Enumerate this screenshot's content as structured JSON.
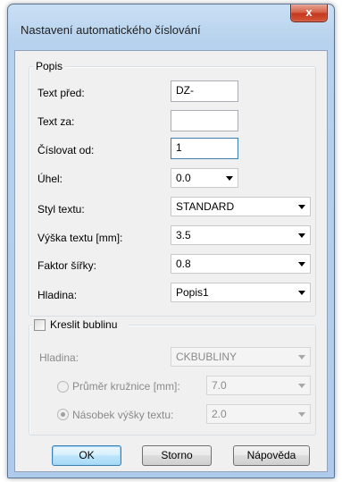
{
  "window": {
    "title": "Nastavení automatického číslování",
    "close_glyph": "x"
  },
  "popis": {
    "legend": "Popis",
    "text_pred": {
      "label": "Text před:",
      "value": "DZ-"
    },
    "text_za": {
      "label": "Text za:",
      "value": ""
    },
    "cislovat_od": {
      "label": "Číslovat od:",
      "value": "1"
    },
    "uhel": {
      "label": "Úhel:",
      "value": "0.0"
    },
    "styl_textu": {
      "label": "Styl textu:",
      "value": "STANDARD"
    },
    "vyska_textu": {
      "label": "Výška textu [mm]:",
      "value": "3.5"
    },
    "faktor_sirky": {
      "label": "Faktor šířky:",
      "value": "0.8"
    },
    "hladina": {
      "label": "Hladina:",
      "value": "Popis1"
    }
  },
  "bublina": {
    "checkbox_label": "Kreslit bublinu",
    "checked": false,
    "hladina": {
      "label": "Hladina:",
      "value": "CKBUBLINY"
    },
    "prumer": {
      "label": "Průměr kružnice [mm]:",
      "value": "7.0",
      "selected": false
    },
    "nasobek": {
      "label": "Násobek výšky textu:",
      "value": "2.0",
      "selected": true
    }
  },
  "buttons": {
    "ok": "OK",
    "storno": "Storno",
    "napoveda": "Nápověda"
  }
}
